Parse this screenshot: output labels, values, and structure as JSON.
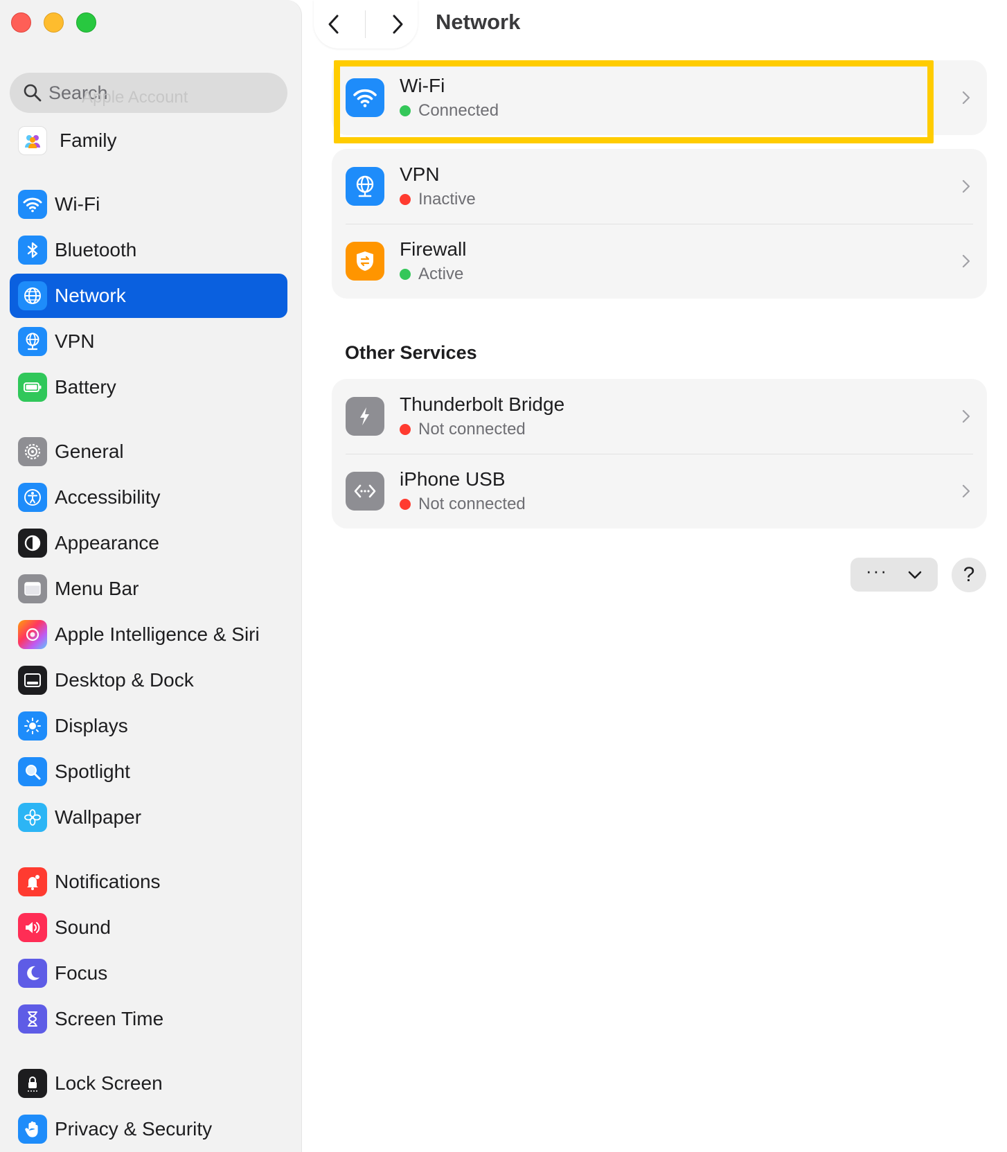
{
  "window": {
    "title": "Network"
  },
  "search": {
    "placeholder": "Search",
    "ghost_text": "Apple Account"
  },
  "sidebar": {
    "family": "Family",
    "items": [
      {
        "label": "Wi-Fi",
        "icon": "wifi-icon",
        "selected": false
      },
      {
        "label": "Bluetooth",
        "icon": "bluetooth-icon",
        "selected": false
      },
      {
        "label": "Network",
        "icon": "globe-icon",
        "selected": true
      },
      {
        "label": "VPN",
        "icon": "vpn-globe-icon",
        "selected": false
      },
      {
        "label": "Battery",
        "icon": "battery-icon",
        "selected": false
      },
      {
        "label": "General",
        "icon": "gear-icon",
        "selected": false
      },
      {
        "label": "Accessibility",
        "icon": "accessibility-icon",
        "selected": false
      },
      {
        "label": "Appearance",
        "icon": "appearance-icon",
        "selected": false
      },
      {
        "label": "Menu Bar",
        "icon": "menu-bar-icon",
        "selected": false
      },
      {
        "label": "Apple Intelligence & Siri",
        "icon": "siri-icon",
        "selected": false
      },
      {
        "label": "Desktop & Dock",
        "icon": "dock-icon",
        "selected": false
      },
      {
        "label": "Displays",
        "icon": "sun-icon",
        "selected": false
      },
      {
        "label": "Spotlight",
        "icon": "magnifier-icon",
        "selected": false
      },
      {
        "label": "Wallpaper",
        "icon": "flower-icon",
        "selected": false
      },
      {
        "label": "Notifications",
        "icon": "bell-icon",
        "selected": false
      },
      {
        "label": "Sound",
        "icon": "speaker-icon",
        "selected": false
      },
      {
        "label": "Focus",
        "icon": "moon-icon",
        "selected": false
      },
      {
        "label": "Screen Time",
        "icon": "hourglass-icon",
        "selected": false
      },
      {
        "label": "Lock Screen",
        "icon": "lock-icon",
        "selected": false
      },
      {
        "label": "Privacy & Security",
        "icon": "hand-icon",
        "selected": false
      }
    ]
  },
  "services": [
    {
      "title": "Wi-Fi",
      "status": "Connected",
      "status_color": "#34c759"
    },
    {
      "title": "VPN",
      "status": "Inactive",
      "status_color": "#ff3b30"
    },
    {
      "title": "Firewall",
      "status": "Active",
      "status_color": "#34c759"
    }
  ],
  "other_services": {
    "heading": "Other Services",
    "items": [
      {
        "title": "Thunderbolt Bridge",
        "status": "Not connected",
        "status_color": "#ff3b30"
      },
      {
        "title": "iPhone USB",
        "status": "Not connected",
        "status_color": "#ff3b30"
      }
    ]
  },
  "footer": {
    "more_label": "···",
    "help_label": "?"
  },
  "colors": {
    "accent": "#0a60df",
    "highlight": "#ffcc00"
  }
}
